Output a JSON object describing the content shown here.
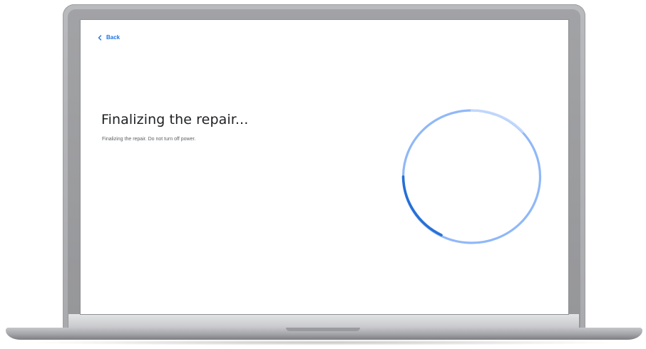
{
  "nav": {
    "back_label": "Back",
    "back_icon": "chevron-left-icon"
  },
  "main": {
    "title": "Finalizing the repair...",
    "subtitle": "Finalizing the repair. Do not turn off power."
  },
  "colors": {
    "accent": "#1a73e8",
    "spinner_light": "#8ab4f8",
    "spinner_dark": "#1967d2",
    "title_text": "#202124",
    "body_text": "#5f6368"
  }
}
